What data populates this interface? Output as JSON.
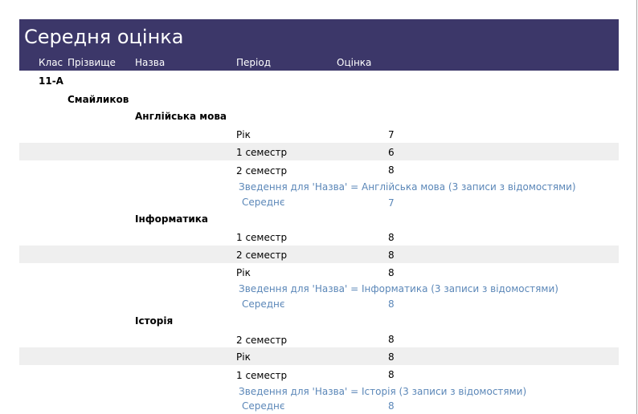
{
  "report": {
    "title": "Середня оцінка",
    "columns": {
      "class": "Клас",
      "surname": "Прізвище",
      "subject": "Назва",
      "period": "Період",
      "grade": "Оцінка"
    },
    "group_class": "11-А",
    "group_student": "Смайликов",
    "subjects": [
      {
        "name": "Англійська мова",
        "rows": [
          {
            "period": "Рік",
            "grade": "7"
          },
          {
            "period": "1 семестр",
            "grade": "6"
          },
          {
            "period": "2 семестр",
            "grade": "8"
          }
        ],
        "summary": "Зведення для 'Назва' =  Англійська мова (3 записи з відомостями)",
        "avg_label": "Середнє",
        "avg_value": "7"
      },
      {
        "name": "Інформатика",
        "rows": [
          {
            "period": "1 семестр",
            "grade": "8"
          },
          {
            "period": "2 семестр",
            "grade": "8"
          },
          {
            "period": "Рік",
            "grade": "8"
          }
        ],
        "summary": "Зведення для 'Назва' = Інформатика (3 записи з відомостями)",
        "avg_label": "Середнє",
        "avg_value": "8"
      },
      {
        "name": "Історія",
        "rows": [
          {
            "period": "2 семестр",
            "grade": "8"
          },
          {
            "period": "Рік",
            "grade": "8"
          },
          {
            "period": "1 семестр",
            "grade": "8"
          }
        ],
        "summary": "Зведення для 'Назва' =  Історія (3 записи з відомостями)",
        "avg_label": "Середнє",
        "avg_value": "8"
      }
    ]
  }
}
